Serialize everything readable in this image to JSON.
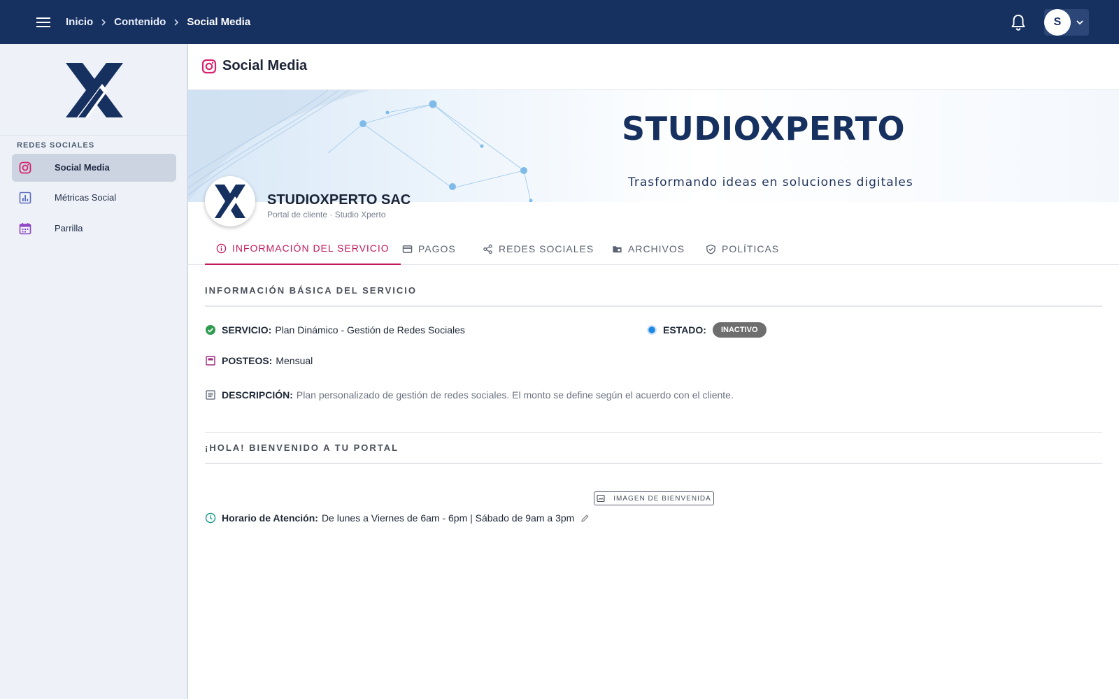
{
  "topbar": {
    "breadcrumbs": [
      "Inicio",
      "Contenido",
      "Social Media"
    ],
    "user_initial": "S"
  },
  "sidebar": {
    "section_label": "REDES SOCIALES",
    "items": [
      {
        "label": "Social Media",
        "icon": "instagram-icon",
        "active": true
      },
      {
        "label": "Métricas Social",
        "icon": "bar-chart-icon",
        "active": false
      },
      {
        "label": "Parrilla",
        "icon": "calendar-icon",
        "active": false
      }
    ]
  },
  "page": {
    "title": "Social Media"
  },
  "banner": {
    "logo_text": "STUDIOXPERTO",
    "tagline": "Trasformando ideas en soluciones digitales"
  },
  "company": {
    "name": "STUDIOXPERTO SAC",
    "subtitle": "Portal de cliente · Studio Xperto"
  },
  "tabs": [
    {
      "label": "INFORMACIÓN DEL SERVICIO",
      "icon": "info-icon",
      "active": true
    },
    {
      "label": "PAGOS",
      "icon": "credit-card-icon",
      "active": false
    },
    {
      "label": "REDES SOCIALES",
      "icon": "share-icon",
      "active": false
    },
    {
      "label": "ARCHIVOS",
      "icon": "folder-icon",
      "active": false
    },
    {
      "label": "POLÍTICAS",
      "icon": "shield-check-icon",
      "active": false
    }
  ],
  "service_info": {
    "section_title": "INFORMACIÓN BÁSICA DEL SERVICIO",
    "servicio_label": "SERVICIO:",
    "servicio_value": "Plan Dinámico - Gestión de Redes Sociales",
    "estado_label": "ESTADO:",
    "estado_value": "INACTIVO",
    "posteos_label": "POSTEOS:",
    "posteos_value": "Mensual",
    "descripcion_label": "DESCRIPCIÓN:",
    "descripcion_value": "Plan personalizado de gestión de redes sociales. El monto se define según el acuerdo con el cliente."
  },
  "welcome": {
    "section_title": "¡HOLA! BIENVENIDO A TU PORTAL",
    "image_button": "IMAGEN DE BIENVENIDA",
    "horario_label": "Horario de Atención:",
    "horario_value": "De lunes a Viernes de 6am - 6pm | Sábado de 9am a 3pm"
  },
  "colors": {
    "topbar": "#16305f",
    "accent": "#c2185b",
    "success": "#2e9b4e",
    "status_dot": "#1e88e5",
    "badge_inactive": "#6e6e6e"
  }
}
